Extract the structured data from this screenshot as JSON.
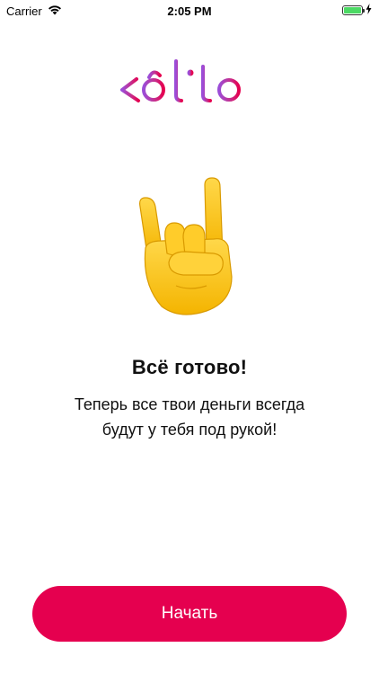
{
  "status_bar": {
    "carrier": "Carrier",
    "time": "2:05 PM",
    "icons": [
      "wifi-icon",
      "battery-icon",
      "charging-bolt-icon"
    ]
  },
  "logo": {
    "text": "kalita",
    "gradient": [
      "#9b4dd8",
      "#e5004f"
    ]
  },
  "hero": {
    "emoji": "sign-of-the-horns-emoji"
  },
  "title": "Всё готово!",
  "subtitle_line1": "Теперь все твои деньги всегда",
  "subtitle_line2": "будут у тебя под рукой!",
  "start_button": {
    "label": "Начать",
    "color": "#e5004f"
  }
}
